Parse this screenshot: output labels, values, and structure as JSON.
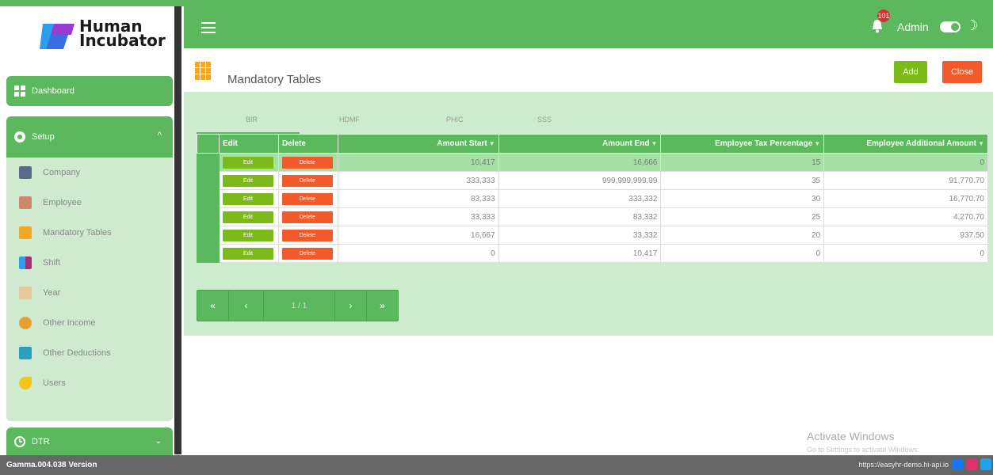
{
  "app": {
    "logo_line1": "Human",
    "logo_line2": "Incubator",
    "version": "Gamma.004.038 Version",
    "footer_url": "https://easyhr-demo.hi-api.io",
    "notification_count": "101",
    "user": "Admin"
  },
  "colors": {
    "primary": "#5cb85c",
    "panel": "#cdeccd",
    "add": "#7cba1a",
    "close": "#f25a2b"
  },
  "sidebar": {
    "dashboard": "Dashboard",
    "setup": "Setup",
    "dtr": "DTR",
    "items": [
      {
        "label": "Company",
        "icon": "building-icon"
      },
      {
        "label": "Employee",
        "icon": "employee-icon"
      },
      {
        "label": "Mandatory Tables",
        "icon": "grid-icon"
      },
      {
        "label": "Shift",
        "icon": "shift-icon"
      },
      {
        "label": "Year",
        "icon": "calendar-icon"
      },
      {
        "label": "Other Income",
        "icon": "money-bag-icon"
      },
      {
        "label": "Other Deductions",
        "icon": "deductions-icon"
      },
      {
        "label": "Users",
        "icon": "key-icon"
      }
    ]
  },
  "page": {
    "title": "Mandatory Tables",
    "add_label": "Add",
    "close_label": "Close",
    "tabs": [
      "BIR",
      "HDMF",
      "PHIC",
      "SSS"
    ],
    "columns": [
      "Edit",
      "Delete",
      "Amount Start",
      "Amount End",
      "Employee Tax Percentage",
      "Employee Additional Amount"
    ],
    "edit_label": "Edit",
    "delete_label": "Delete",
    "rows": [
      [
        "10,417",
        "16,666",
        "15",
        "0"
      ],
      [
        "333,333",
        "999,999,999.99",
        "35",
        "91,770.70"
      ],
      [
        "83,333",
        "333,332",
        "30",
        "16,770.70"
      ],
      [
        "33,333",
        "83,332",
        "25",
        "4,270.70"
      ],
      [
        "16,667",
        "33,332",
        "20",
        "937.50"
      ],
      [
        "0",
        "10,417",
        "0",
        "0"
      ]
    ],
    "pager": {
      "first": "«",
      "prev": "‹",
      "info": "1 / 1",
      "next": "›",
      "last": "»"
    }
  },
  "watermark": {
    "title": "Activate Windows",
    "sub": "Go to Settings to activate Windows."
  }
}
